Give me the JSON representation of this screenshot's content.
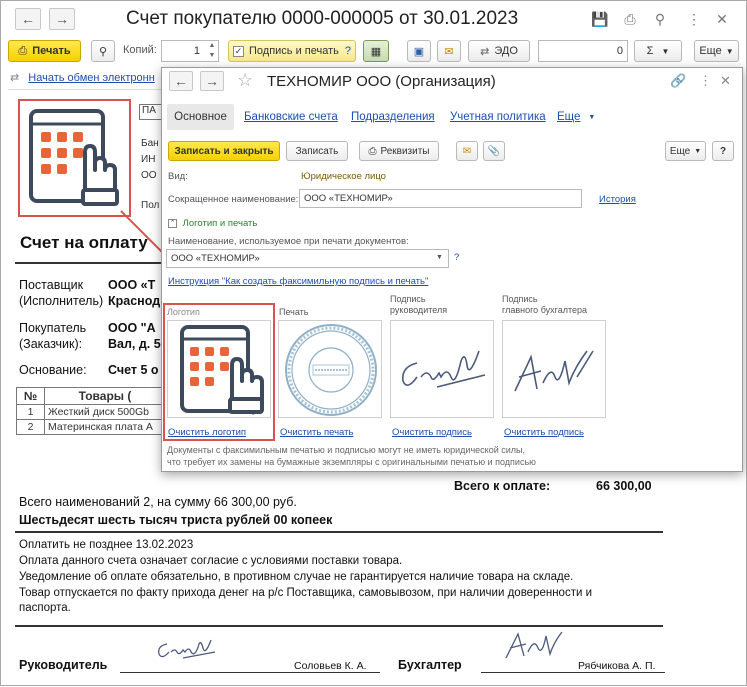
{
  "window": {
    "title": "Счет покупателю 0000-000005 от 30.01.2023"
  },
  "toolbar": {
    "print_label": "Печать",
    "copies_label": "Копий:",
    "copies_value": "1",
    "sign_print_label": "Подпись и печать",
    "help_q": "?",
    "edo_label": "ЭДО",
    "sum_value": "0",
    "sigma_label": "Σ",
    "more_label": "Еще"
  },
  "doc": {
    "exchange_link": "Начать обмен электронн",
    "title": "Счет на оплату",
    "supplier_label1": "Поставщик",
    "supplier_label2": "(Исполнитель)",
    "supplier_val1": "ООО «Т",
    "supplier_val2": "Краснод",
    "buyer_label1": "Покупатель",
    "buyer_label2": "(Заказчик):",
    "buyer_val1": "ООО \"А",
    "buyer_val2": "Вал, д. 5",
    "basis_label": "Основание:",
    "basis_val": "Счет 5 о",
    "table_head_no": "№",
    "table_head_goods": "Товары (",
    "rows": [
      {
        "no": "1",
        "name": "Жесткий диск 500Gb"
      },
      {
        "no": "2",
        "name": "Материнская плата А"
      }
    ],
    "head_frag": {
      "pa": "ПА",
      "bank": "Бан",
      "inn": "ИН",
      "oo": "ОО",
      "pol": "Пол"
    },
    "total_label": "Всего к оплате:",
    "total_value": "66 300,00",
    "summary": "Всего наименований 2, на сумму 66 300,00 руб.",
    "in_words": "Шестьдесят шесть тысяч триста рублей 00 копеек",
    "pay_until": "Оплатить не позднее 13.02.2023",
    "note1": "Оплата данного счета означает согласие с условиями поставки товара.",
    "note2": "Уведомление об оплате обязательно, в противном случае не гарантируется наличие товара на складе.",
    "note3": "Товар отпускается по факту прихода денег на р/с Поставщика, самовывозом, при наличии доверенности и",
    "note4": "паспорта.",
    "head_label": "Руководитель",
    "head_name": "Соловьев К. А.",
    "acc_label": "Бухгалтер",
    "acc_name": "Рябчикова А. П."
  },
  "dialog": {
    "title": "ТЕХНОМИР ООО (Организация)",
    "tabs": [
      "Основное",
      "Банковские счета",
      "Подразделения",
      "Учетная политика",
      "Еще"
    ],
    "save_close": "Записать и закрыть",
    "save": "Записать",
    "requisites": "Реквизиты",
    "more": "Еще",
    "help": "?",
    "kind_label": "Вид:",
    "kind_value": "Юридическое лицо",
    "short_name_label": "Сокращенное наименование:",
    "short_name_value": "ООО «ТЕХНОМИР»",
    "history_link": "История",
    "logo_section": "Логотип и печать",
    "print_name_label": "Наименование, используемое при печати документов:",
    "print_name_value": "ООО «ТЕХНОМИР»",
    "instruction_link": "Инструкция \"Как создать факсимильную подпись и печать\"",
    "captions": {
      "logo": "Логотип",
      "stamp": "Печать",
      "head1": "Подпись",
      "head2": "руководителя",
      "acc1": "Подпись",
      "acc2": "главного бухгалтера"
    },
    "clear_logo": "Очистить логотип",
    "clear_stamp": "Очистить печать",
    "clear_sign1": "Очистить подпись",
    "clear_sign2": "Очистить подпись",
    "note1": "Документы с факсимильным печатью и подписью могут не иметь юридической силы,",
    "note2": "что требует их замены на бумажные экземпляры с оригинальными печатью и подписью"
  },
  "colors": {
    "accent_yellow": "#f5d100",
    "link_blue": "#1c4fb0",
    "highlight_red": "#d9534f",
    "logo_orange": "#e8653a",
    "logo_dark": "#3d4a5c"
  }
}
